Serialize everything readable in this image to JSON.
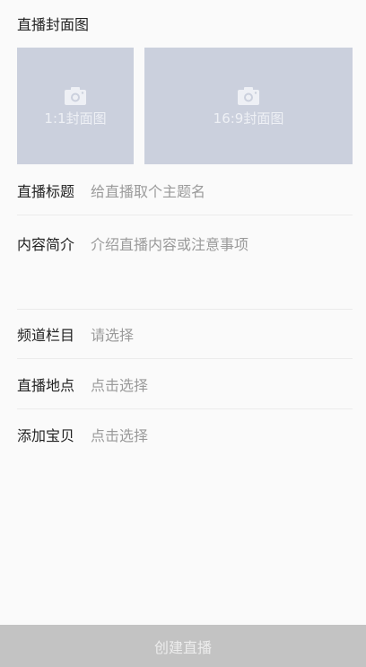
{
  "cover_section": {
    "title": "直播封面图",
    "square_label": "1:1封面图",
    "wide_label": "16:9封面图",
    "icon": "camera-icon"
  },
  "form": {
    "title_label": "直播标题",
    "title_placeholder": "给直播取个主题名",
    "intro_label": "内容简介",
    "intro_placeholder": "介绍直播内容或注意事项",
    "channel_label": "频道栏目",
    "channel_value": "请选择",
    "location_label": "直播地点",
    "location_value": "点击选择",
    "goods_label": "添加宝贝",
    "goods_value": "点击选择"
  },
  "submit_label": "创建直播",
  "colors": {
    "cover_bg": "#cbd0dd",
    "submit_bg": "#c3c3c3",
    "placeholder": "#9a9a9a"
  }
}
